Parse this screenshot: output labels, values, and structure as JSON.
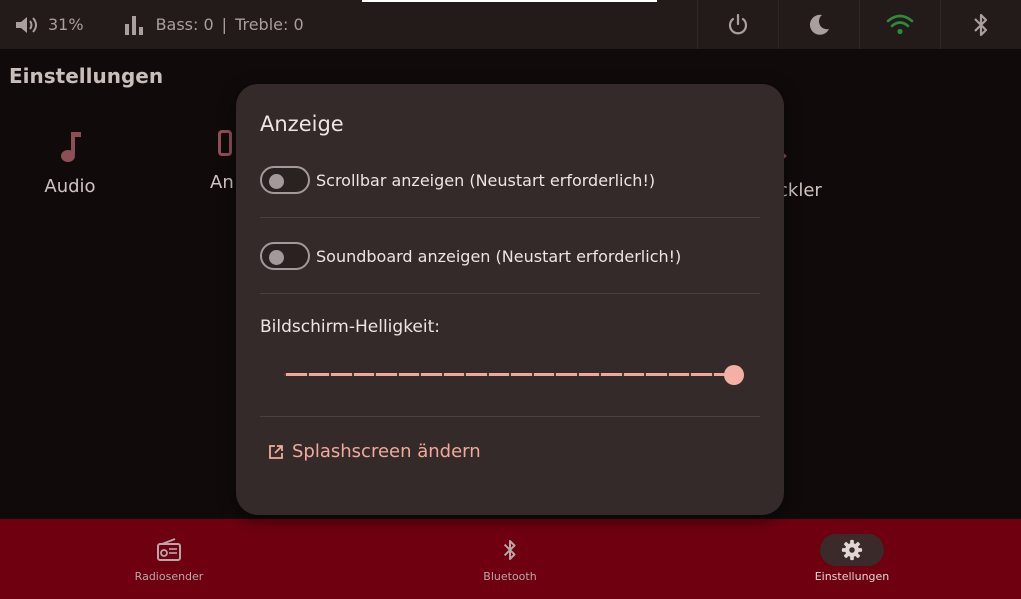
{
  "statusbar": {
    "volume": "31%",
    "bass": "Bass: 0",
    "separator": "|",
    "treble": "Treble: 0",
    "buttons": [
      {
        "icon": "power-icon"
      },
      {
        "icon": "moon-icon"
      },
      {
        "icon": "wifi-icon"
      },
      {
        "icon": "bluetooth-icon"
      }
    ]
  },
  "page": {
    "title": "Einstellungen",
    "tiles": [
      {
        "label": "Audio",
        "icon": "music-note-icon"
      },
      {
        "label": "An"
      },
      {
        "label": "ckler"
      }
    ]
  },
  "dialog": {
    "title": "Anzeige",
    "toggle_scrollbar": {
      "label": "Scrollbar anzeigen (Neustart erforderlich!)",
      "checked": false
    },
    "toggle_soundboard": {
      "label": "Soundboard anzeigen (Neustart erforderlich!)",
      "checked": false
    },
    "brightness": {
      "label": "Bildschirm-Helligkeit:",
      "value": 1.0,
      "ticks": 20
    },
    "splash_link": {
      "label": "Splashscreen ändern",
      "icon": "open-in-new-icon"
    }
  },
  "nav": {
    "items": [
      {
        "label": "Radiosender",
        "icon": "radio-icon",
        "active": false
      },
      {
        "label": "Bluetooth",
        "icon": "bluetooth-icon",
        "active": false
      },
      {
        "label": "Einstellungen",
        "icon": "gear-icon",
        "active": true
      }
    ]
  },
  "colors": {
    "accent": "#f5b0a5",
    "nav_background": "#6f0010",
    "wifi": "#2e8b3a"
  }
}
